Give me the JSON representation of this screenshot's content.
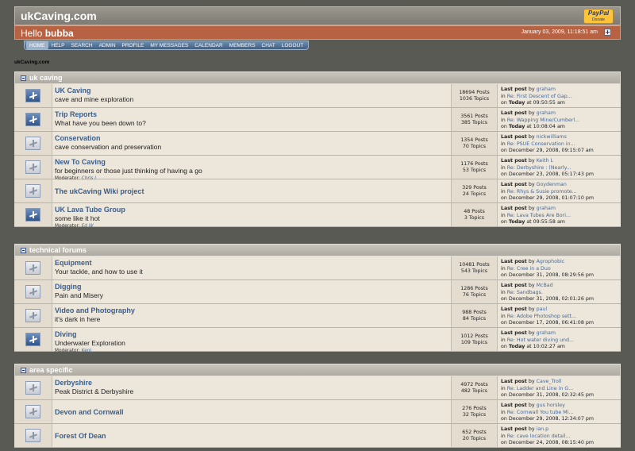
{
  "site": {
    "title": "ukCaving.com",
    "paypal_brand": "PayPal",
    "paypal_action": "Donate"
  },
  "greeting": {
    "prefix": "Hello",
    "user": "bubba",
    "date": "January 03, 2009, 11:18:51 am"
  },
  "nav": [
    "HOME",
    "HELP",
    "SEARCH",
    "ADMIN",
    "PROFILE",
    "MY MESSAGES",
    "CALENDAR",
    "MEMBERS",
    "CHAT",
    "LOGOUT"
  ],
  "breadcrumb": "ukCaving.com",
  "categories": [
    {
      "title": "uk caving",
      "boards": [
        {
          "icon": "new",
          "name": "UK Caving",
          "desc": "cave and mine exploration",
          "mod": "",
          "posts": "18694 Posts",
          "topics": "1036 Topics",
          "lp_by": "graham",
          "lp_topic": "Re: First Descent of Gap...",
          "lp_on": "on",
          "lp_date": "Today",
          "lp_time": "at 09:50:55 am"
        },
        {
          "icon": "new",
          "name": "Trip Reports",
          "desc": "What have you been down to?",
          "mod": "",
          "posts": "3561 Posts",
          "topics": "385 Topics",
          "lp_by": "graham",
          "lp_topic": "Re: Wapping Mine/Cumberl...",
          "lp_on": "on",
          "lp_date": "Today",
          "lp_time": "at 10:08:04 am"
        },
        {
          "icon": "old",
          "name": "Conservation",
          "desc": "cave conservation and preservation",
          "mod": "",
          "posts": "1354 Posts",
          "topics": "70 Topics",
          "lp_by": "nickwilliams",
          "lp_topic": "Re: PSUE Conservation in...",
          "lp_on": "on December 29, 2008, 09:15:07 am",
          "lp_date": "",
          "lp_time": ""
        },
        {
          "icon": "old",
          "name": "New To Caving",
          "desc": "for beginners or those just thinking of having a go",
          "mod": "Chris J",
          "posts": "1176 Posts",
          "topics": "53 Topics",
          "lp_by": "Keith L",
          "lp_topic": "Re: Derbyshire : (Nearly...",
          "lp_on": "on December 23, 2008, 05:17:43 pm",
          "lp_date": "",
          "lp_time": ""
        },
        {
          "icon": "old",
          "name": "The ukCaving Wiki project",
          "desc": "",
          "mod": "",
          "posts": "329 Posts",
          "topics": "24 Topics",
          "lp_by": "Goydenman",
          "lp_topic": "Re: Rhys & Susie promote...",
          "lp_on": "on December 29, 2008, 01:07:10 pm",
          "lp_date": "",
          "lp_time": ""
        },
        {
          "icon": "new",
          "name": "UK Lava Tube Group",
          "desc": "some like it hot",
          "mod": "Ed W",
          "posts": "48 Posts",
          "topics": "3 Topics",
          "lp_by": "graham",
          "lp_topic": "Re: Lava Tubes Are Bori...",
          "lp_on": "on",
          "lp_date": "Today",
          "lp_time": "at 09:55:58 am"
        }
      ]
    },
    {
      "title": "technical forums",
      "boards": [
        {
          "icon": "old",
          "name": "Equipment",
          "desc": "Your tackle, and how to use it",
          "mod": "",
          "posts": "10481 Posts",
          "topics": "543 Topics",
          "lp_by": "Agrophobic",
          "lp_topic": "Re: Cree in a Duo",
          "lp_on": "on December 31, 2008, 08:29:56 pm",
          "lp_date": "",
          "lp_time": ""
        },
        {
          "icon": "old",
          "name": "Digging",
          "desc": "Pain and Misery",
          "mod": "",
          "posts": "1286 Posts",
          "topics": "76 Topics",
          "lp_by": "McBad",
          "lp_topic": "Re: Sandbags.",
          "lp_on": "on December 31, 2008, 02:01:26 pm",
          "lp_date": "",
          "lp_time": ""
        },
        {
          "icon": "old",
          "name": "Video and Photography",
          "desc": "it's dark in here",
          "mod": "",
          "posts": "988 Posts",
          "topics": "84 Topics",
          "lp_by": "paul",
          "lp_topic": "Re: Adobe Photoshop sett...",
          "lp_on": "on December 17, 2008, 06:41:08 pm",
          "lp_date": "",
          "lp_time": ""
        },
        {
          "icon": "new",
          "name": "Diving",
          "desc": "Underwater Exploration",
          "mod": "KenJ",
          "posts": "1012 Posts",
          "topics": "109 Topics",
          "lp_by": "graham",
          "lp_topic": "Re: Hot water diving und...",
          "lp_on": "on",
          "lp_date": "Today",
          "lp_time": "at 10:02:27 am"
        }
      ]
    },
    {
      "title": "area specific",
      "boards": [
        {
          "icon": "old",
          "name": "Derbyshire",
          "desc": "Peak District & Derbyshire",
          "mod": "",
          "posts": "4972 Posts",
          "topics": "482 Topics",
          "lp_by": "Cave_Troll",
          "lp_topic": "Re: Ladder and Line in G...",
          "lp_on": "on December 31, 2008, 02:32:45 pm",
          "lp_date": "",
          "lp_time": ""
        },
        {
          "icon": "old",
          "name": "Devon and Cornwall",
          "desc": "",
          "mod": "",
          "posts": "276 Posts",
          "topics": "32 Topics",
          "lp_by": "gus horsley",
          "lp_topic": "Re: Cornwall You tube Mi...",
          "lp_on": "on December 29, 2008, 12:34:07 pm",
          "lp_date": "",
          "lp_time": ""
        },
        {
          "icon": "old",
          "name": "Forest Of Dean",
          "desc": "",
          "mod": "",
          "posts": "652 Posts",
          "topics": "20 Topics",
          "lp_by": "ian.p",
          "lp_topic": "Re: cave location detail...",
          "lp_on": "on December 24, 2008, 08:15:40 pm",
          "lp_date": "",
          "lp_time": ""
        }
      ]
    }
  ],
  "labels": {
    "last_post": "Last post",
    "by": "by",
    "in": "in",
    "moderator": "Moderator:"
  },
  "colors": {
    "background": "#5a5a55",
    "hello_bar": "#b76242",
    "link": "#3c5e8a",
    "row": "#ece6db"
  }
}
